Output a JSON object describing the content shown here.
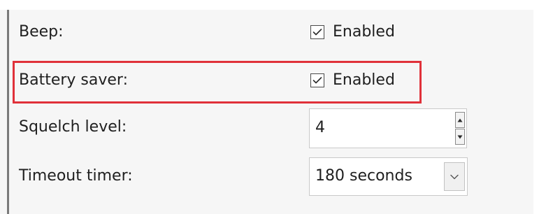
{
  "settings": {
    "beep": {
      "label": "Beep:",
      "checkbox_label": "Enabled",
      "checked": true
    },
    "battery_saver": {
      "label": "Battery saver:",
      "checkbox_label": "Enabled",
      "checked": true,
      "highlighted": true
    },
    "squelch_level": {
      "label": "Squelch level:",
      "value": "4"
    },
    "timeout_timer": {
      "label": "Timeout timer:",
      "value": "180 seconds"
    }
  },
  "colors": {
    "highlight_border": "#e0313a",
    "panel_background": "#f6f6f6"
  },
  "icons": {
    "checkbox": "checkmark-icon",
    "spin_up": "spin-up-arrow-icon",
    "spin_down": "spin-down-arrow-icon",
    "dropdown": "chevron-down-icon"
  }
}
